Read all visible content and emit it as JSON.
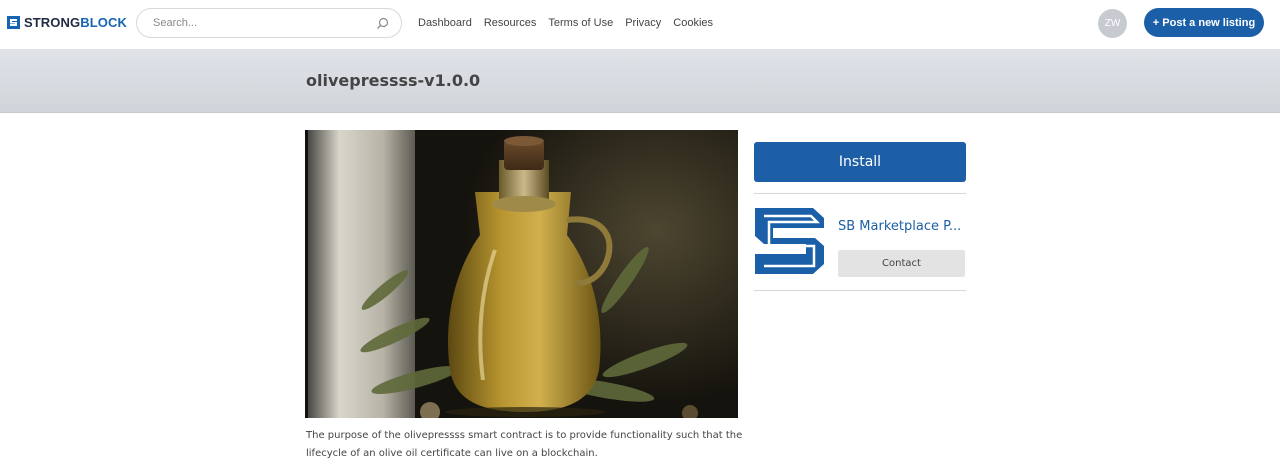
{
  "header": {
    "logo": {
      "text_primary": "STRONG",
      "text_accent": "BLOCK",
      "icon": "strongblock-logo-icon"
    },
    "search": {
      "placeholder": "Search...",
      "value": "",
      "icon": "search-icon"
    },
    "nav": [
      {
        "label": "Dashboard"
      },
      {
        "label": "Resources"
      },
      {
        "label": "Terms of Use"
      },
      {
        "label": "Privacy"
      },
      {
        "label": "Cookies"
      }
    ],
    "avatar_initials": "ZW",
    "post_button_label": "+ Post a new listing"
  },
  "listing": {
    "title": "olivepressss-v1.0.0",
    "image": "olive-oil-bottle-photo",
    "description": "The purpose of the olivepressss smart contract is to provide functionality such that the lifecycle of an olive oil certificate can live on a blockchain."
  },
  "sidebar": {
    "install_label": "Install",
    "publisher": {
      "name": "SB Marketplace P...",
      "logo": "sb-marketplace-logo"
    },
    "contact_label": "Contact"
  },
  "colors": {
    "brand_blue": "#1d5fa6",
    "band_gray": "#d8dce1",
    "button_gray": "#e3e3e3"
  }
}
